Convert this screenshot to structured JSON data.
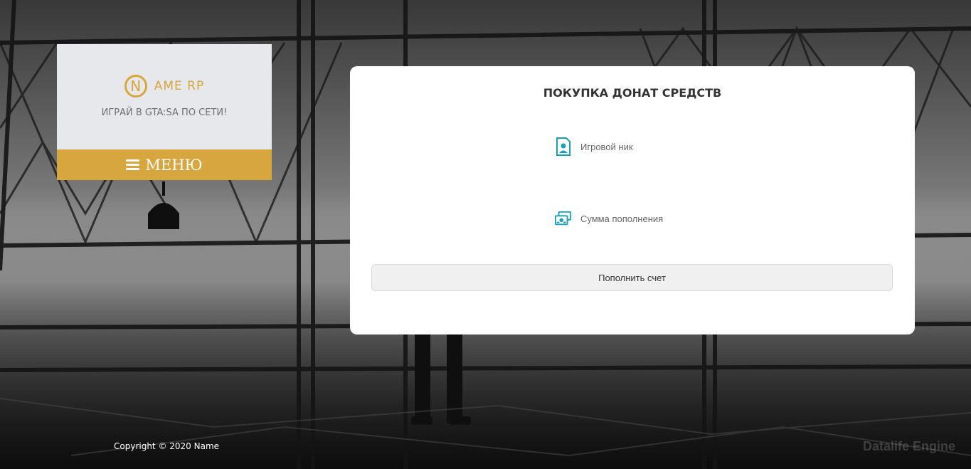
{
  "logo": {
    "letter": "N",
    "name": "AME RP",
    "tagline": "ИГРАЙ В GTA:SA ПО СЕТИ!"
  },
  "menu": {
    "label": "МЕНЮ"
  },
  "card": {
    "title": "ПОКУПКА ДОНАТ СРЕДСТВ",
    "fields": {
      "nick": {
        "placeholder": "Игровой ник",
        "icon": "user-badge-icon"
      },
      "sum": {
        "placeholder": "Сумма пополнения",
        "icon": "money-icon"
      }
    },
    "button_label": "Пополнить счет"
  },
  "footer": {
    "copyright": "Copyright © 2020 Name",
    "engine": "Datalife Engine"
  },
  "colors": {
    "accent": "#d7a63e",
    "icon_teal": "#1ba1b5",
    "logo_bg": "#e6e8ec"
  }
}
